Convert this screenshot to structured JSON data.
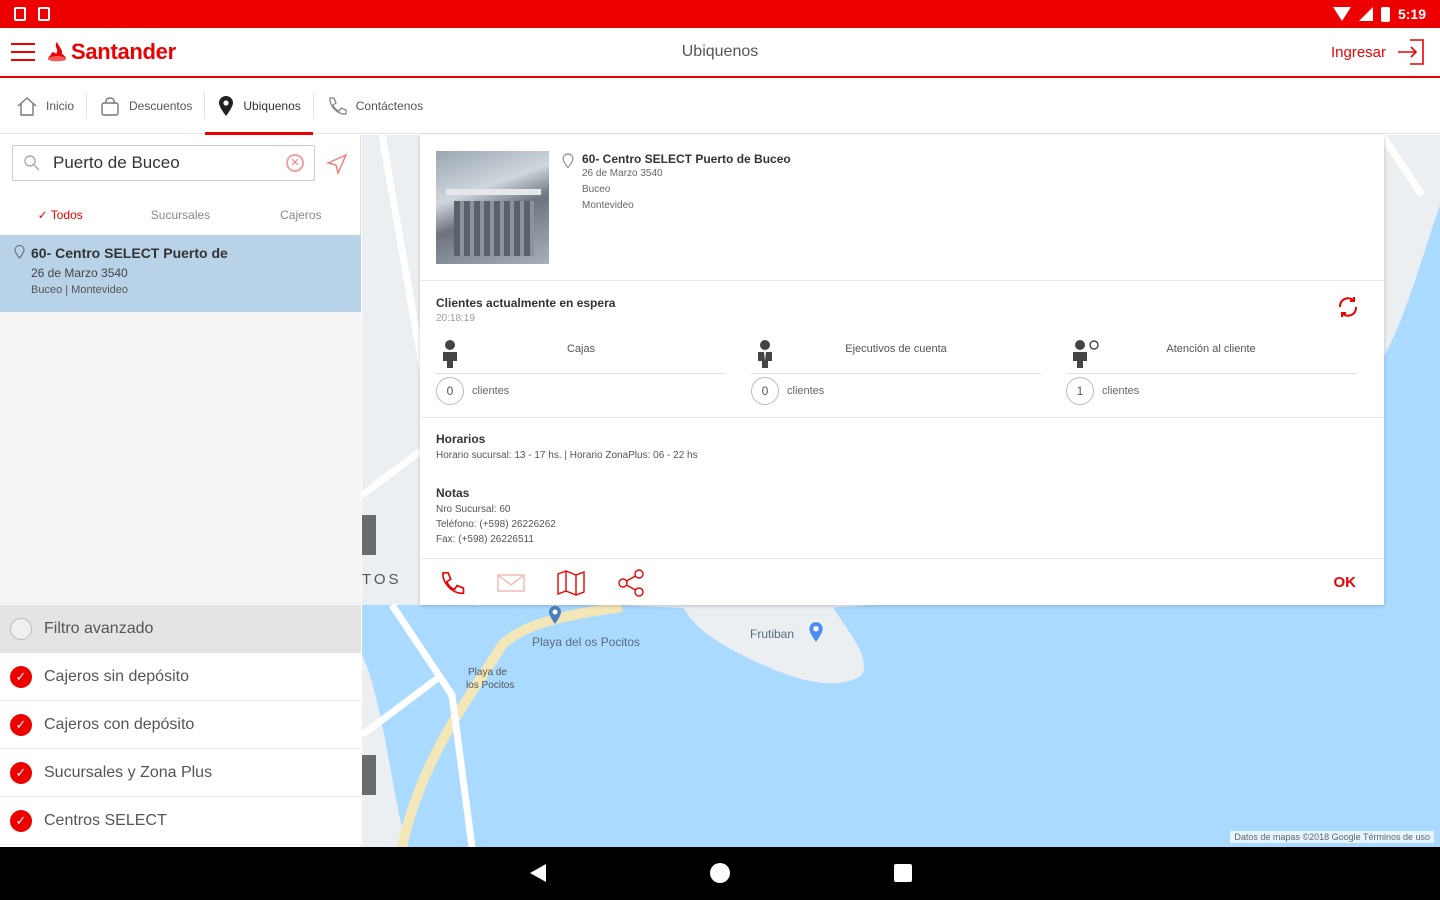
{
  "status_bar": {
    "time": "5:19"
  },
  "app": {
    "brand": "Santander",
    "title": "Ubiquenos",
    "login_label": "Ingresar"
  },
  "tabs": [
    {
      "label": "Inicio",
      "icon": "home-icon"
    },
    {
      "label": "Descuentos",
      "icon": "shopping-bag-icon"
    },
    {
      "label": "Ubiquenos",
      "icon": "location-pin-icon",
      "active": true
    },
    {
      "label": "Contáctenos",
      "icon": "phone-icon"
    }
  ],
  "search": {
    "value": "Puerto de Buceo"
  },
  "filters": [
    {
      "label": "Todos",
      "active": true
    },
    {
      "label": "Sucursales"
    },
    {
      "label": "Cajeros"
    }
  ],
  "result": {
    "title": "60- Centro SELECT Puerto de",
    "address": "26 de Marzo 3540",
    "city": "Buceo | Montevideo"
  },
  "advanced_filter": {
    "title": "Filtro avanzado",
    "items": [
      {
        "label": "Cajeros sin depósito",
        "checked": true
      },
      {
        "label": "Cajeros con depósito",
        "checked": true
      },
      {
        "label": "Sucursales y Zona Plus",
        "checked": true
      },
      {
        "label": "Centros SELECT",
        "checked": true
      }
    ]
  },
  "detail": {
    "title": "60- Centro SELECT Puerto de Buceo",
    "address": "26 de Marzo 3540",
    "neighborhood": "Buceo",
    "city": "Montevideo",
    "waiting": {
      "title": "Clientes actualmente en espera",
      "time": "20:18:19",
      "columns": [
        {
          "label": "Cajas",
          "count": "0",
          "unit": "clientes"
        },
        {
          "label": "Ejecutivos de cuenta",
          "count": "0",
          "unit": "clientes"
        },
        {
          "label": "Atención al cliente",
          "count": "1",
          "unit": "clientes"
        }
      ]
    },
    "hours": {
      "title": "Horarios",
      "text": "Horario sucursal: 13 - 17 hs. | Horario ZonaPlus: 06 - 22 hs"
    },
    "notes": {
      "title": "Notas",
      "lines": [
        "Nro Sucursal: 60",
        "Teléfono: (+598) 26226262",
        "Fax: (+598) 26226511"
      ]
    },
    "ok_label": "OK"
  },
  "map": {
    "labels": {
      "playa": "Playa del os Pocitos",
      "frutiban": "Frutiban",
      "playa2_line1": "Playa de",
      "playa2_line2": "los Pocitos",
      "tos": "TOS"
    },
    "attribution": "Datos de mapas ©2018 Google   Términos de uso"
  },
  "colors": {
    "brand": "#ec0000",
    "selected_row": "#b8d3e8",
    "water": "#aadaff"
  }
}
